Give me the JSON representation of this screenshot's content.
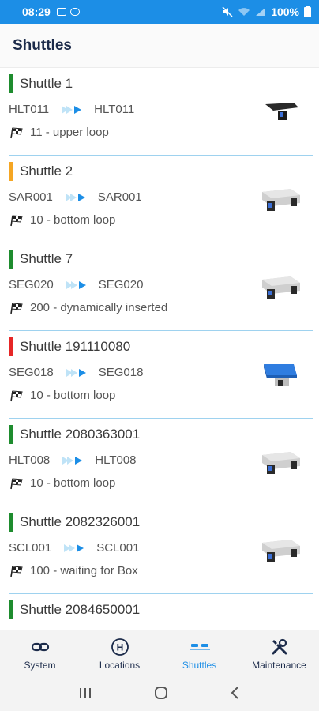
{
  "status_bar": {
    "time": "08:29",
    "battery": "100%"
  },
  "header": {
    "title": "Shuttles"
  },
  "colors": {
    "accent": "#1c8ee6",
    "green": "#1e8c2e",
    "orange": "#f5a623",
    "red": "#e62626",
    "divider": "#9ed2ef"
  },
  "shuttles": [
    {
      "name": "Shuttle 1",
      "status_color": "#1e8c2e",
      "from": "HLT011",
      "to": "HLT011",
      "destination": "11 - upper loop",
      "thumb": "dark"
    },
    {
      "name": "Shuttle 2",
      "status_color": "#f5a623",
      "from": "SAR001",
      "to": "SAR001",
      "destination": "10 - bottom loop",
      "thumb": "silver"
    },
    {
      "name": "Shuttle 7",
      "status_color": "#1e8c2e",
      "from": "SEG020",
      "to": "SEG020",
      "destination": "200 - dynamically inserted",
      "thumb": "silver"
    },
    {
      "name": "Shuttle 191110080",
      "status_color": "#e62626",
      "from": "SEG018",
      "to": "SEG018",
      "destination": "10 - bottom loop",
      "thumb": "box"
    },
    {
      "name": "Shuttle 2080363001",
      "status_color": "#1e8c2e",
      "from": "HLT008",
      "to": "HLT008",
      "destination": "10 - bottom loop",
      "thumb": "silver"
    },
    {
      "name": "Shuttle 2082326001",
      "status_color": "#1e8c2e",
      "from": "SCL001",
      "to": "SCL001",
      "destination": "100 - waiting for Box",
      "thumb": "silver"
    },
    {
      "name": "Shuttle 2084650001",
      "status_color": "#1e8c2e",
      "from": "",
      "to": "",
      "destination": "",
      "thumb": "silver"
    }
  ],
  "nav": {
    "items": [
      {
        "label": "System",
        "icon": "link-icon"
      },
      {
        "label": "Locations",
        "icon": "location-h-icon"
      },
      {
        "label": "Shuttles",
        "icon": "shuttle-icon",
        "active": true
      },
      {
        "label": "Maintenance",
        "icon": "tools-icon"
      }
    ]
  }
}
